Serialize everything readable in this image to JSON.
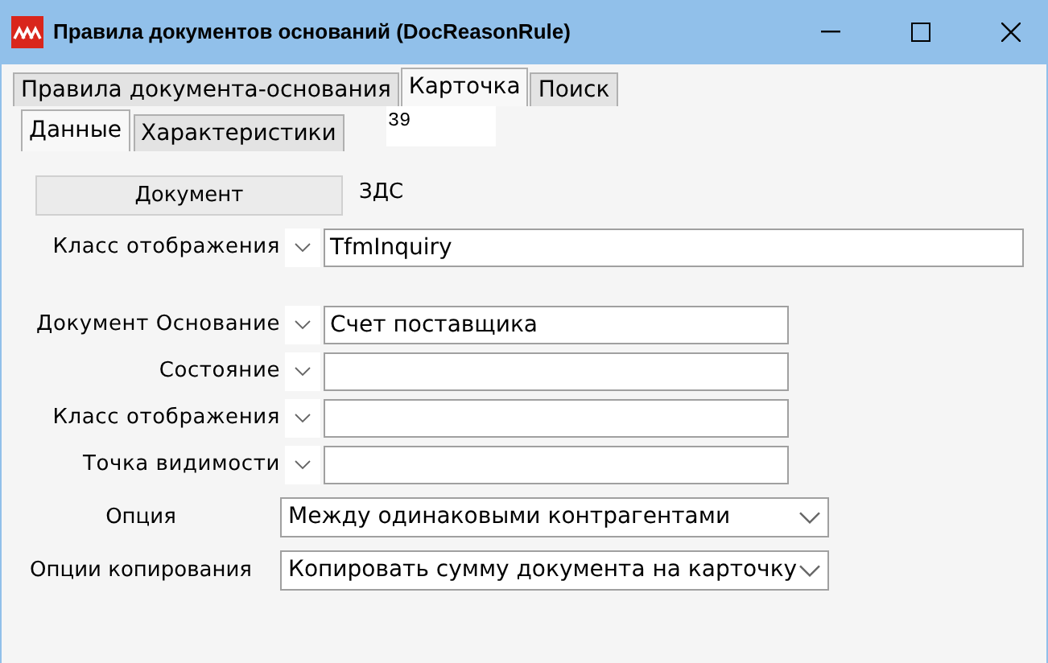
{
  "window": {
    "title": "Правила документов оснований (DocReasonRule)"
  },
  "tabs": [
    {
      "label": "Правила документа-основания",
      "selected": false
    },
    {
      "label": "Карточка",
      "selected": true
    },
    {
      "label": "Поиск",
      "selected": false
    }
  ],
  "subtabs": [
    {
      "label": "Данные",
      "selected": true
    },
    {
      "label": "Характеристики",
      "selected": false
    }
  ],
  "record_number": "39",
  "document_button": "Документ",
  "document_code": "ЗДС",
  "fields": [
    {
      "kind": "wide_lookup",
      "label": "Класс отображения",
      "value": "TfmInquiry"
    },
    {
      "kind": "lookup",
      "label": "Документ Основание",
      "value": "Счет поставщика"
    },
    {
      "kind": "lookup",
      "label": "Состояние"
    },
    {
      "kind": "lookup",
      "label": "Класс отображения"
    },
    {
      "kind": "lookup",
      "label": "Точка видимости"
    },
    {
      "kind": "select",
      "label": "Опция",
      "value": "Между одинаковыми контрагентами"
    },
    {
      "kind": "select",
      "label": "Опции копирования",
      "value": "Копировать сумму документа на карточку"
    }
  ]
}
